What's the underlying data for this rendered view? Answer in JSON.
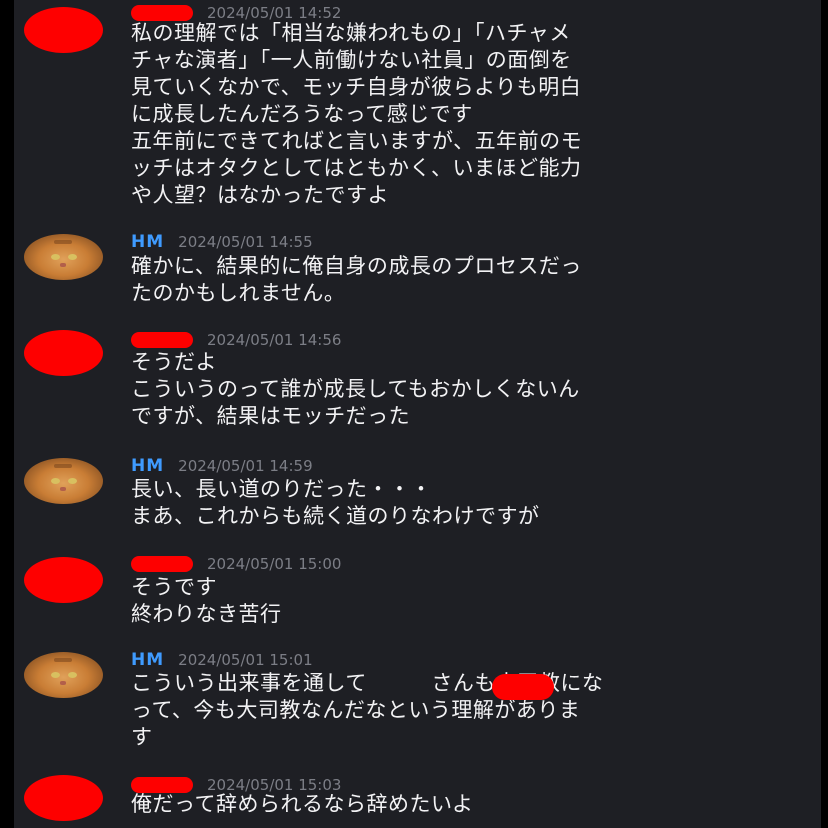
{
  "messages": [
    {
      "author": "",
      "timestamp": "2024/05/01 14:52",
      "lines": [
        "私の理解では「相当な嫌われもの」「ハチャメ",
        "チャな演者」「一人前働けない社員」の面倒を",
        "見ていくなかで、モッチ自身が彼らよりも明白",
        "に成長したんだろうなって感じです",
        "五年前にできてればと言いますが、五年前のモ",
        "ッチはオタクとしてはともかく、いまほど能力",
        "や人望？はなかったですよ"
      ]
    },
    {
      "author": "HM",
      "timestamp": "2024/05/01 14:55",
      "lines": [
        "確かに、結果的に俺自身の成長のプロセスだっ",
        "たのかもしれません。"
      ]
    },
    {
      "author": "",
      "timestamp": "2024/05/01 14:56",
      "lines": [
        "そうだよ",
        "こういうのって誰が成長してもおかしくないん",
        "ですが、結果はモッチだった"
      ]
    },
    {
      "author": "HM",
      "timestamp": "2024/05/01 14:59",
      "lines": [
        "長い、長い道のりだった・・・",
        "まあ、これからも続く道のりなわけですが"
      ]
    },
    {
      "author": "",
      "timestamp": "2024/05/01 15:00",
      "lines": [
        "そうです",
        "終わりなき苦行"
      ]
    },
    {
      "author": "HM",
      "timestamp": "2024/05/01 15:01",
      "lines": [
        "こういう出来事を通して　　　さんも大司教にな",
        "って、今も大司教なんだなという理解がありま",
        "す"
      ]
    },
    {
      "author": "",
      "timestamp": "2024/05/01 15:03",
      "lines": [
        "俺だって辞められるなら辞めたいよ"
      ]
    }
  ]
}
